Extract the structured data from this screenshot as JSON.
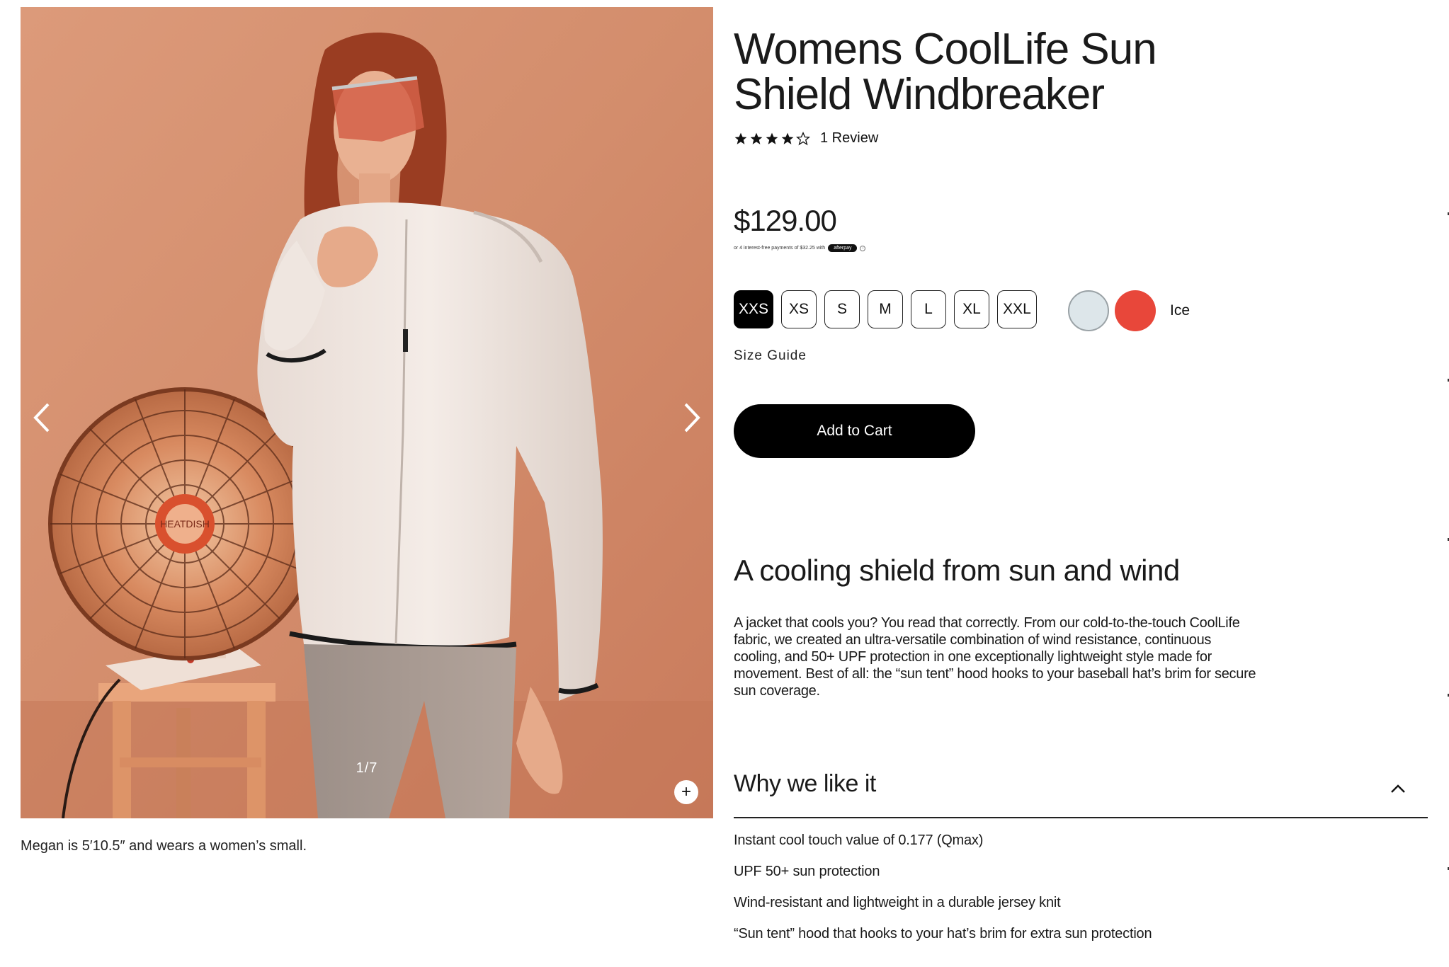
{
  "gallery": {
    "slide_counter": "1/7",
    "zoom_label": "+",
    "caption": "Megan is 5′10.5″ and wears a women’s small.",
    "heater_label": "HEATDISH",
    "prev_icon": "chevron-left-icon",
    "next_icon": "chevron-right-icon"
  },
  "product": {
    "title": "Womens CoolLife Sun Shield Windbreaker",
    "rating": {
      "stars": 4,
      "max": 5,
      "review_text": "1 Review"
    },
    "price": "$129.00",
    "installments": {
      "text": "or 4 interest-free payments of $32.25 with",
      "badge": "afterpay",
      "info": "i"
    },
    "sizes": [
      {
        "label": "XXS",
        "selected": true
      },
      {
        "label": "XS",
        "selected": false
      },
      {
        "label": "S",
        "selected": false
      },
      {
        "label": "M",
        "selected": false
      },
      {
        "label": "L",
        "selected": false
      },
      {
        "label": "XL",
        "selected": false
      },
      {
        "label": "XXL",
        "selected": false
      }
    ],
    "colors": [
      {
        "name": "Ice",
        "hex": "#dde6ea",
        "selected": true
      },
      {
        "name": "Red",
        "hex": "#e8473a",
        "selected": false
      }
    ],
    "selected_color_name": "Ice",
    "size_guide": "Size Guide",
    "add_to_cart": "Add to Cart"
  },
  "description": {
    "heading": "A cooling shield from sun and wind",
    "body": "A jacket that cools you? You read that correctly. From our cold-to-the-touch CoolLife fabric, we created an ultra-versatile combination of wind resistance, continuous cooling, and 50+ UPF protection in one exceptionally lightweight style made for movement. Best of all: the “sun tent” hood hooks to your baseball hat’s brim for secure sun coverage."
  },
  "why_we_like_it": {
    "title": "Why we like it",
    "expanded": true,
    "chevron_icon": "chevron-up-icon",
    "items": [
      "Instant cool touch value of 0.177 (Qmax)",
      "UPF 50+ sun protection",
      "Wind-resistant and lightweight in a durable jersey knit",
      "“Sun tent” hood that hooks to your hat’s brim for extra sun protection"
    ]
  },
  "colors": {
    "button_black": "#000000",
    "text": "#1a1a1a",
    "photo_background": "#d48f6f"
  }
}
